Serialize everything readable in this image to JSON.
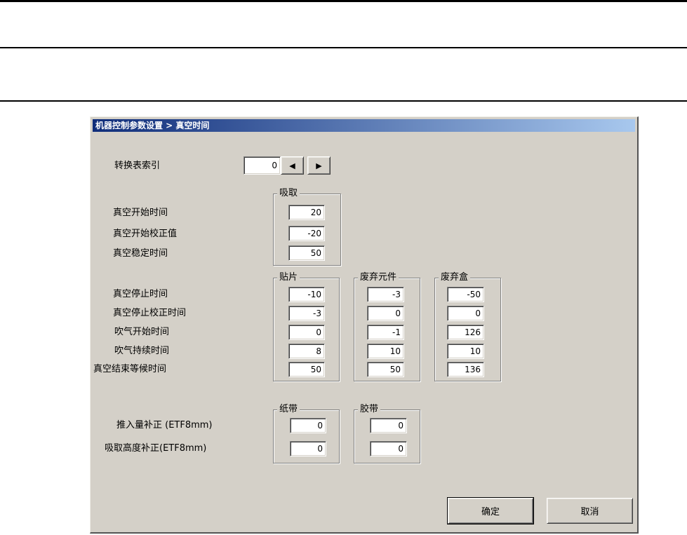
{
  "dialog": {
    "title": "机器控制参数设置 > 真空时间"
  },
  "index_row": {
    "label": "转换表索引",
    "value": "0",
    "left_arrow": "◀",
    "right_arrow": "▶"
  },
  "section1": {
    "group": "吸取",
    "rows": [
      {
        "label": "真空开始时间",
        "value": "20"
      },
      {
        "label": "真空开始校正值",
        "value": "-20"
      },
      {
        "label": "真空稳定时间",
        "value": "50"
      }
    ]
  },
  "section2": {
    "labels": [
      "真空停止时间",
      "真空停止校正时间",
      "吹气开始时间",
      "吹气持续时间",
      "真空结束等候时间"
    ],
    "groups": [
      {
        "name": "贴片",
        "values": [
          "-10",
          "-3",
          "0",
          "8",
          "50"
        ]
      },
      {
        "name": "废弃元件",
        "values": [
          "-3",
          "0",
          "-1",
          "10",
          "50"
        ]
      },
      {
        "name": "废弃盒",
        "values": [
          "-50",
          "0",
          "126",
          "10",
          "136"
        ]
      }
    ]
  },
  "section3": {
    "labels": [
      "推入量补正 (ETF8mm)",
      "吸取高度补正(ETF8mm)"
    ],
    "groups": [
      {
        "name": "纸带",
        "values": [
          "0",
          "0"
        ]
      },
      {
        "name": "胶带",
        "values": [
          "0",
          "0"
        ]
      }
    ]
  },
  "buttons": {
    "ok": "确定",
    "cancel": "取消"
  },
  "colors": {
    "dialog_bg": "#d4d0c8",
    "titlebar_start": "#0f2d7a",
    "titlebar_end": "#a8c8ee",
    "field_bg": "#ffffff",
    "title_text": "#ffffff"
  }
}
